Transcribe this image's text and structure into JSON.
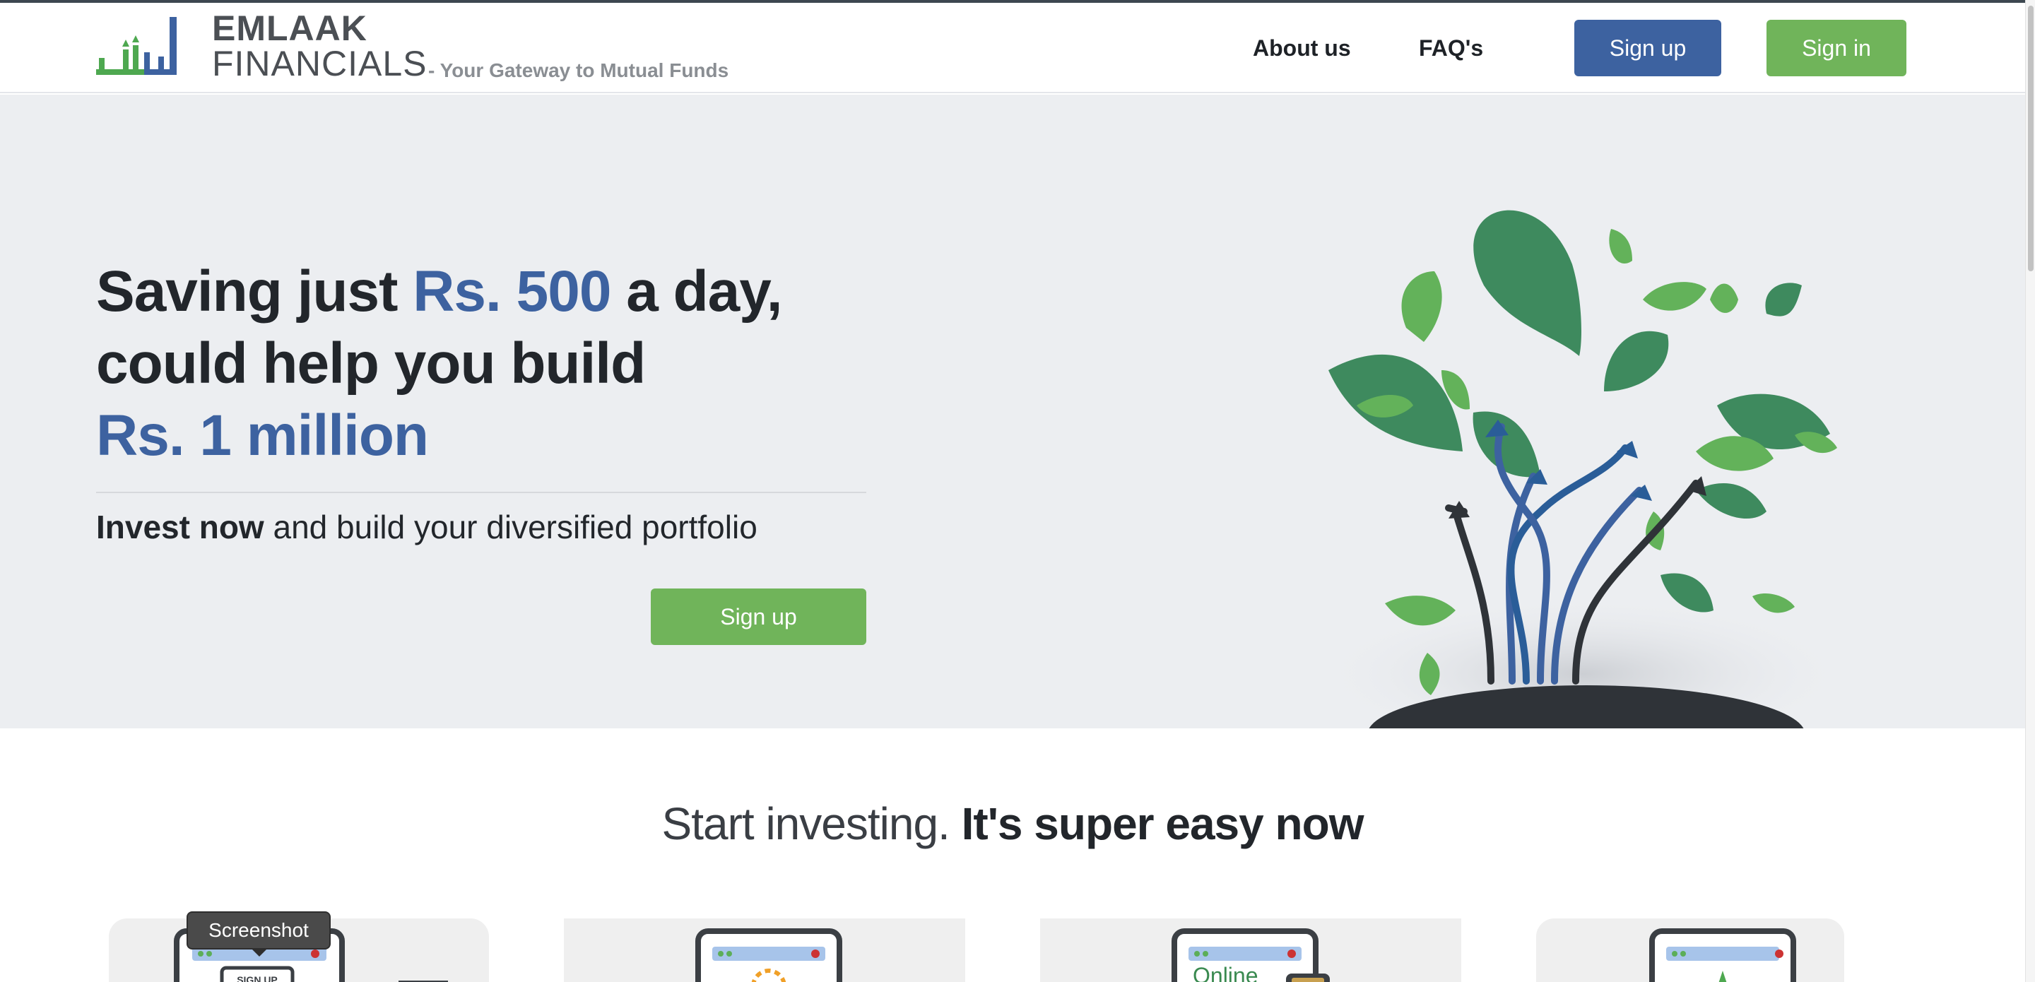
{
  "header": {
    "brand_line1": "EMLAAK",
    "brand_line2": "FINANCIALS",
    "tagline": "- Your Gateway to Mutual Funds",
    "nav": {
      "about": "About us",
      "faq": "FAQ's"
    },
    "signup_label": "Sign up",
    "signin_label": "Sign in"
  },
  "hero": {
    "title_part1": "Saving just ",
    "title_highlight1": "Rs. 500",
    "title_part2": " a day,",
    "title_line2": "could help you build",
    "title_highlight2": "Rs. 1 million",
    "subtitle_bold": "Invest now",
    "subtitle_rest": " and build your diversified portfolio",
    "cta_label": "Sign up"
  },
  "steps_section": {
    "title_light": "Start investing.",
    "title_bold": " It's super easy now",
    "cards": [
      {
        "icon": "signup-screen-illustration",
        "label": "SIGN UP"
      },
      {
        "icon": "settings-screen-illustration"
      },
      {
        "icon": "online-screen-illustration",
        "label": "Online"
      },
      {
        "icon": "growth-screen-illustration"
      }
    ]
  },
  "tooltip": "Screenshot",
  "colors": {
    "brand_blue": "#3d62a0",
    "brand_green": "#70b45a",
    "hero_bg": "#eceef1",
    "text_dark": "#22262b"
  }
}
